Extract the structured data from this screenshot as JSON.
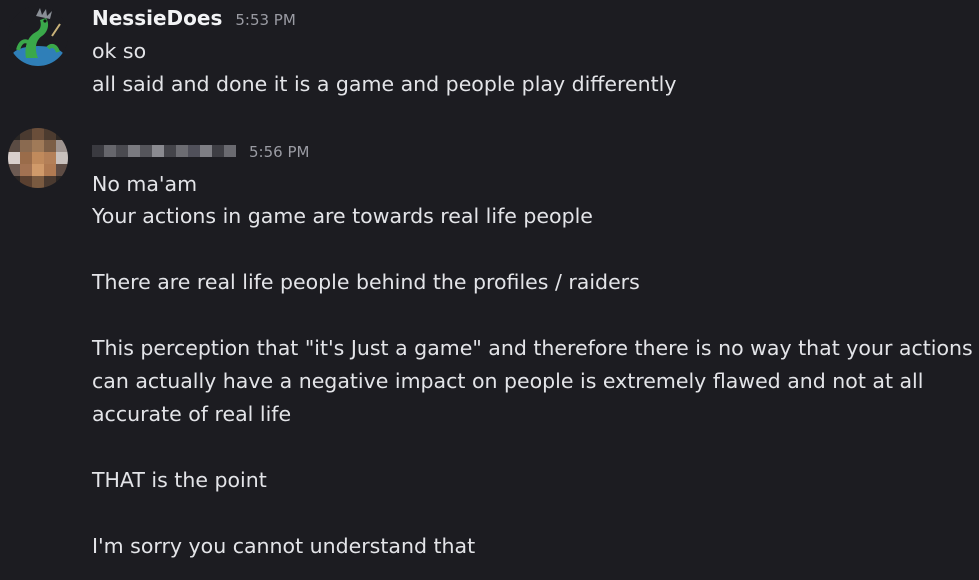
{
  "messages": [
    {
      "username": "NessieDoes",
      "timestamp": "5:53 PM",
      "avatar_icon": "nessie-dragon-avatar",
      "lines": [
        "ok so",
        "all said and done it is a game and people play differently"
      ]
    },
    {
      "username_redacted": true,
      "timestamp": "5:56 PM",
      "avatar_icon": "pixelated-avatar",
      "lines": [
        "No ma'am",
        "Your actions in game are towards real life people",
        "There are real life people behind the profiles / raiders",
        "This perception that \"it's Just a game\" and therefore there is no way that your actions",
        "can actually have a negative impact on people is extremely flawed and not at all",
        "accurate of real life",
        "THAT is the point",
        "I'm sorry you cannot understand that"
      ]
    }
  ],
  "colors": {
    "background": "#1c1c21",
    "text": "#e3e4e8",
    "username": "#f2f3f5",
    "timestamp": "#9a9ba3"
  }
}
